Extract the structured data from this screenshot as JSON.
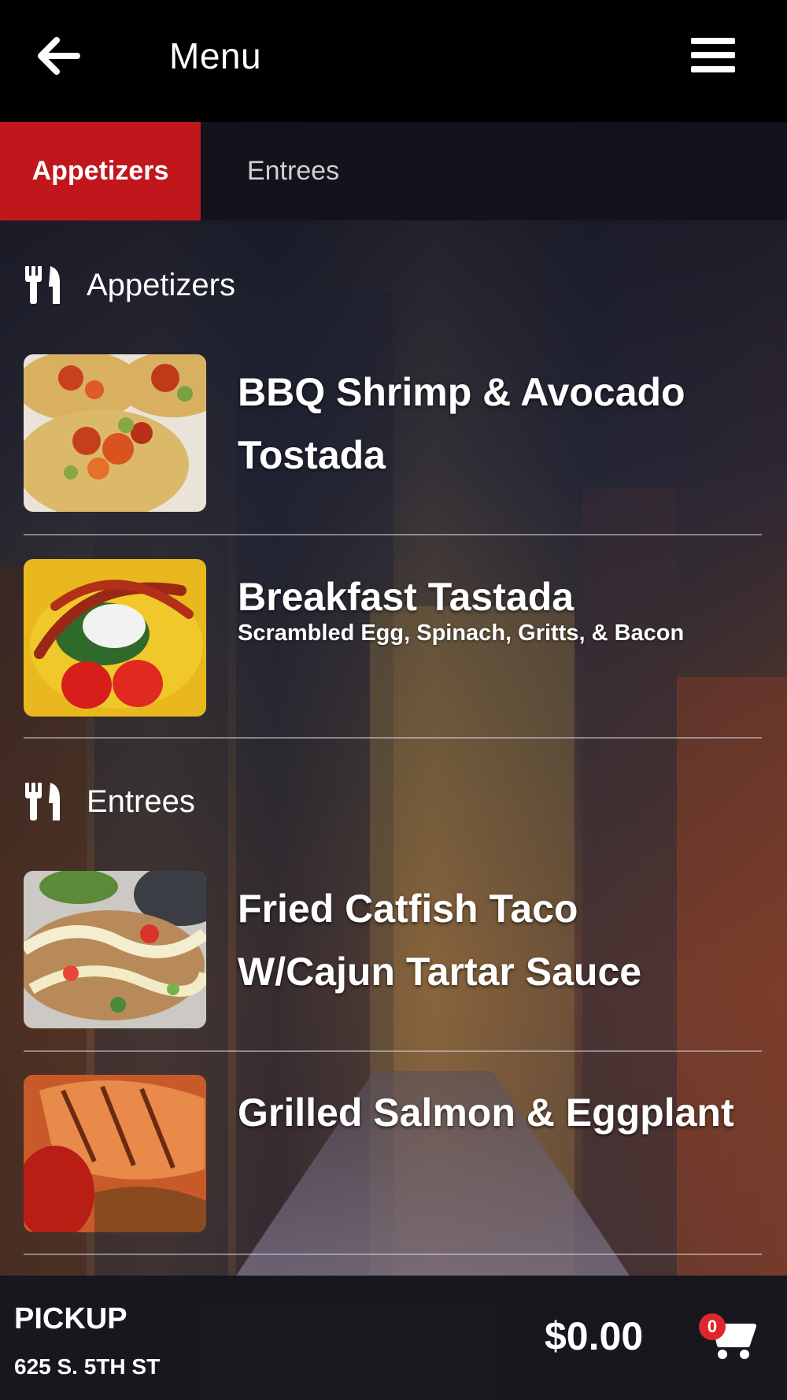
{
  "header": {
    "title": "Menu",
    "back_icon": "arrow-left-icon",
    "menu_icon": "hamburger-icon"
  },
  "tabs": [
    {
      "label": "Appetizers",
      "active": true
    },
    {
      "label": "Entrees",
      "active": false
    }
  ],
  "sections": [
    {
      "title": "Appetizers",
      "icon": "fork-knife-icon",
      "items": [
        {
          "name": "BBQ Shrimp & Avocado Tostada",
          "description": ""
        },
        {
          "name": "Breakfast Tastada",
          "description": "Scrambled Egg, Spinach, Gritts, & Bacon"
        }
      ]
    },
    {
      "title": "Entrees",
      "icon": "fork-knife-icon",
      "items": [
        {
          "name": "Fried Catfish Taco W/Cajun Tartar Sauce",
          "description": ""
        },
        {
          "name": "Grilled Salmon & Eggplant",
          "description": ""
        }
      ]
    }
  ],
  "footer": {
    "order_type": "PICKUP",
    "address": "625 S. 5TH ST",
    "total": "$0.00",
    "cart_count": "0",
    "cart_icon": "shopping-cart-icon"
  },
  "colors": {
    "accent": "#c0161c",
    "topbar": "#000000",
    "badge": "#e0262c"
  }
}
